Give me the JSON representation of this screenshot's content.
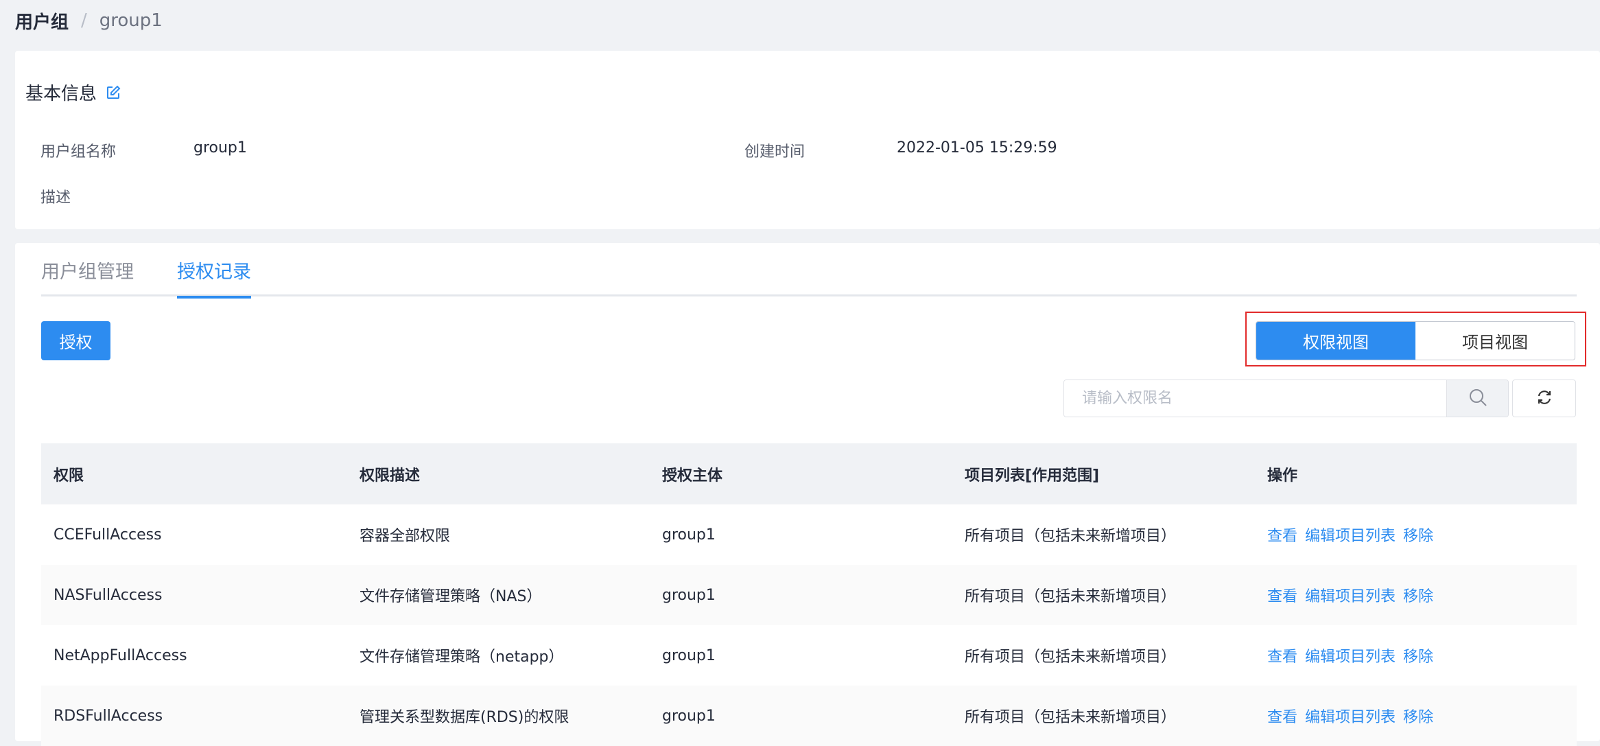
{
  "breadcrumb": {
    "root": "用户组",
    "separator": "/",
    "current": "group1"
  },
  "basic_info": {
    "title": "基本信息",
    "name_label": "用户组名称",
    "name_value": "group1",
    "created_label": "创建时间",
    "created_value": "2022-01-05 15:29:59",
    "desc_label": "描述",
    "desc_value": ""
  },
  "tabs": [
    {
      "label": "用户组管理",
      "active": false
    },
    {
      "label": "授权记录",
      "active": true
    }
  ],
  "toolbar": {
    "authorize_label": "授权",
    "view_switch": [
      {
        "label": "权限视图",
        "active": true
      },
      {
        "label": "项目视图",
        "active": false
      }
    ],
    "search_placeholder": "请输入权限名"
  },
  "table": {
    "columns": [
      "权限",
      "权限描述",
      "授权主体",
      "项目列表[作用范围]",
      "操作"
    ],
    "rows": [
      {
        "permission": "CCEFullAccess",
        "description": "容器全部权限",
        "principal": "group1",
        "scope": "所有项目（包括未来新增项目）",
        "actions": [
          "查看",
          "编辑项目列表",
          "移除"
        ]
      },
      {
        "permission": "NASFullAccess",
        "description": "文件存储管理策略（NAS）",
        "principal": "group1",
        "scope": "所有项目（包括未来新增项目）",
        "actions": [
          "查看",
          "编辑项目列表",
          "移除"
        ]
      },
      {
        "permission": "NetAppFullAccess",
        "description": "文件存储管理策略（netapp）",
        "principal": "group1",
        "scope": "所有项目（包括未来新增项目）",
        "actions": [
          "查看",
          "编辑项目列表",
          "移除"
        ]
      },
      {
        "permission": "RDSFullAccess",
        "description": "管理关系型数据库(RDS)的权限",
        "principal": "group1",
        "scope": "所有项目（包括未来新增项目）",
        "actions": [
          "查看",
          "编辑项目列表",
          "移除"
        ]
      }
    ]
  },
  "colors": {
    "accent": "#2d8cf0",
    "highlight_border": "#e22b2b",
    "page_bg": "#f0f2f5"
  }
}
